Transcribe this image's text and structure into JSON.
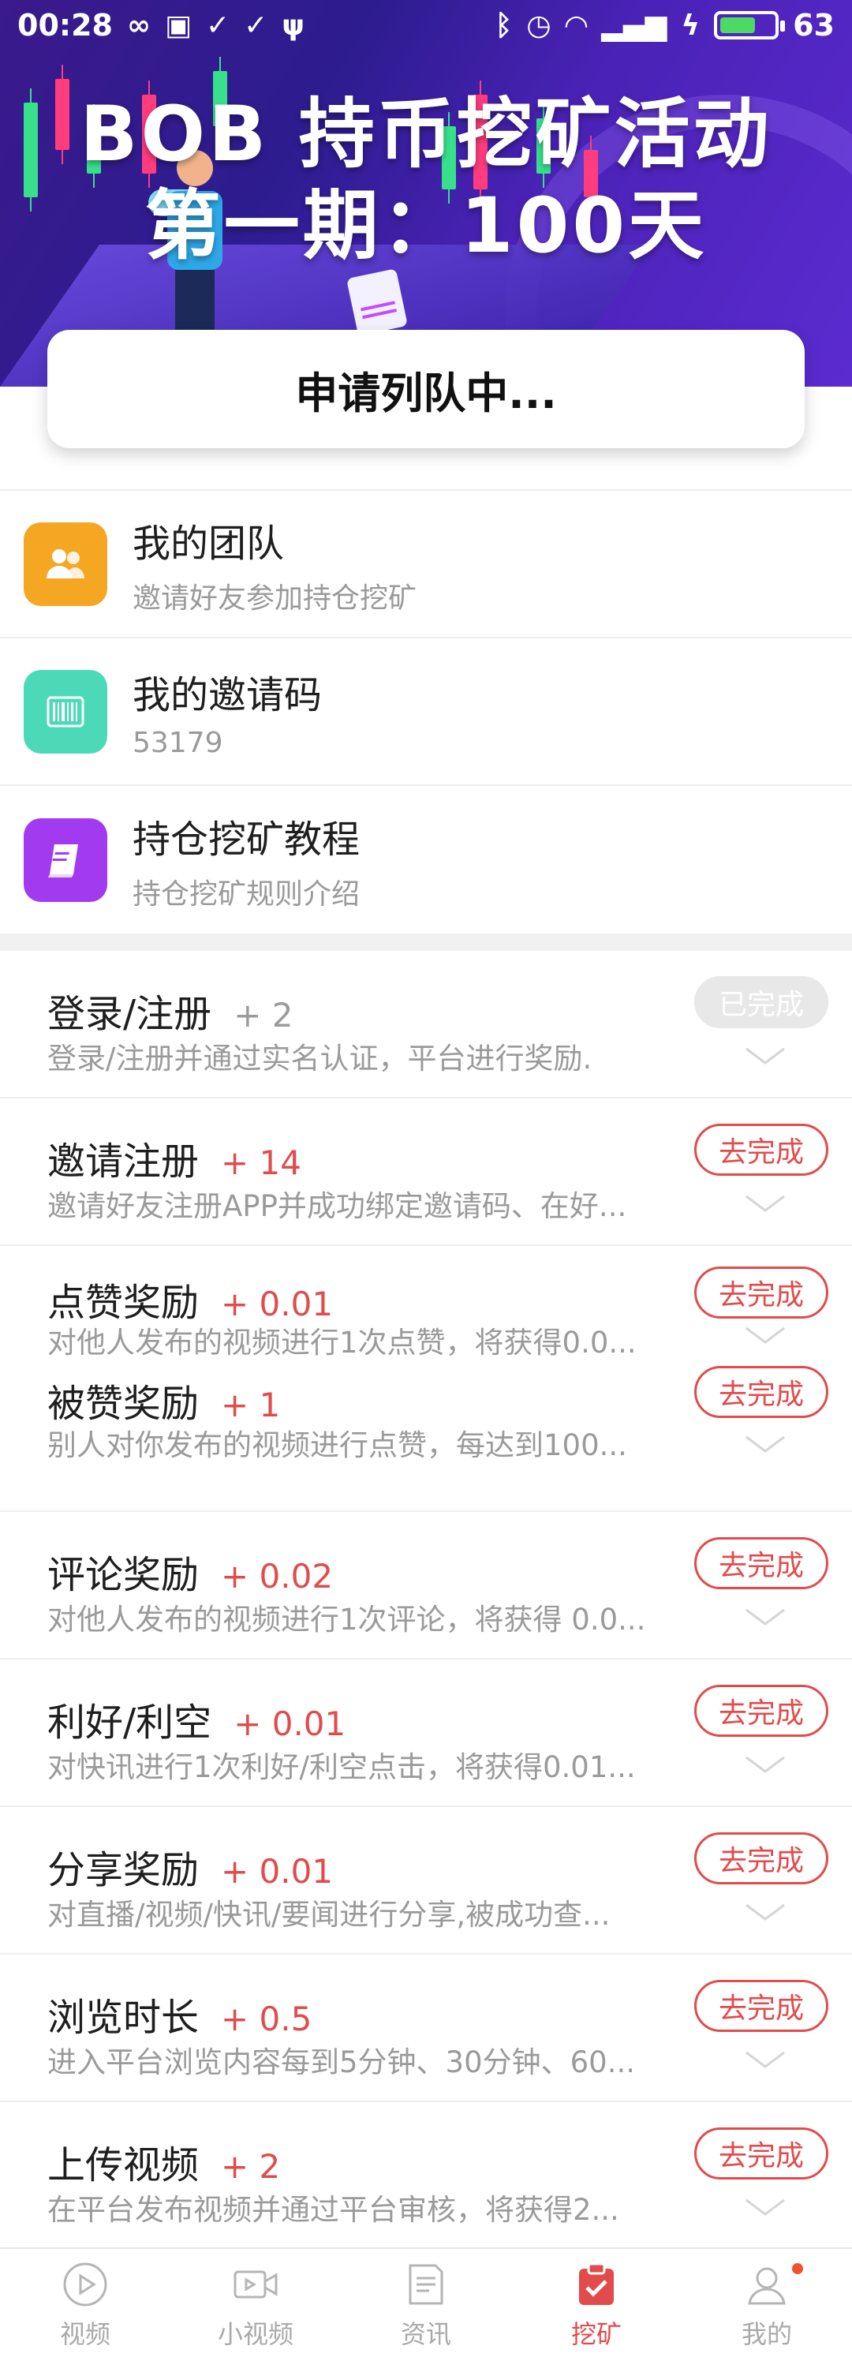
{
  "status_bar": {
    "time": "00:28",
    "battery": "63"
  },
  "banner": {
    "title_line1": "BOB 持币挖矿活动",
    "title_line2": "第一期：100天"
  },
  "queue_status": "申请列队中...",
  "menu": [
    {
      "title": "我的团队",
      "subtitle": "邀请好友参加持仓挖矿",
      "icon": "team-icon",
      "color": "#f5a623"
    },
    {
      "title": "我的邀请码",
      "subtitle": "53179",
      "icon": "barcode-icon",
      "color": "#4cd9b8"
    },
    {
      "title": "持仓挖矿教程",
      "subtitle": "持仓挖矿规则介绍",
      "icon": "book-icon",
      "color": "#a23bf0"
    }
  ],
  "tasks": [
    {
      "title": "登录/注册",
      "reward": "+ 2",
      "desc": "登录/注册并通过实名认证，平台进行奖励.",
      "button": "已完成",
      "done": true
    },
    {
      "title": "邀请注册",
      "reward": "+ 14",
      "desc": "邀请好友注册APP并成功绑定邀请码、在好...",
      "button": "去完成"
    },
    {
      "title": "点赞奖励",
      "reward": "+ 0.01",
      "desc": "对他人发布的视频进行1次点赞，将获得0.0...",
      "button": "去完成"
    },
    {
      "title": "被赞奖励",
      "reward": "+ 1",
      "desc": "别人对你发布的视频进行点赞，每达到100...",
      "button": "去完成"
    },
    {
      "title": "评论奖励",
      "reward": "+ 0.02",
      "desc": "对他人发布的视频进行1次评论，将获得 0.0...",
      "button": "去完成"
    },
    {
      "title": "利好/利空",
      "reward": "+ 0.01",
      "desc": "对快讯进行1次利好/利空点击，将获得0.01...",
      "button": "去完成"
    },
    {
      "title": "分享奖励",
      "reward": "+ 0.01",
      "desc": "对直播/视频/快讯/要闻进行分享,被成功查...",
      "button": "去完成"
    },
    {
      "title": "浏览时长",
      "reward": "+ 0.5",
      "desc": "进入平台浏览内容每到5分钟、30分钟、60...",
      "button": "去完成"
    },
    {
      "title": "上传视频",
      "reward": "+ 2",
      "desc": "在平台发布视频并通过平台审核，将获得2...",
      "button": "去完成"
    }
  ],
  "tabbar": [
    {
      "label": "视频",
      "icon": "play-icon"
    },
    {
      "label": "小视频",
      "icon": "video-camera-icon"
    },
    {
      "label": "资讯",
      "icon": "news-icon"
    },
    {
      "label": "挖矿",
      "icon": "clipboard-check-icon",
      "active": true
    },
    {
      "label": "我的",
      "icon": "profile-icon",
      "badge": true
    }
  ],
  "colors": {
    "accent": "#e24b4b",
    "banner_start": "#3a1a8c",
    "banner_end": "#5b2bd0"
  }
}
